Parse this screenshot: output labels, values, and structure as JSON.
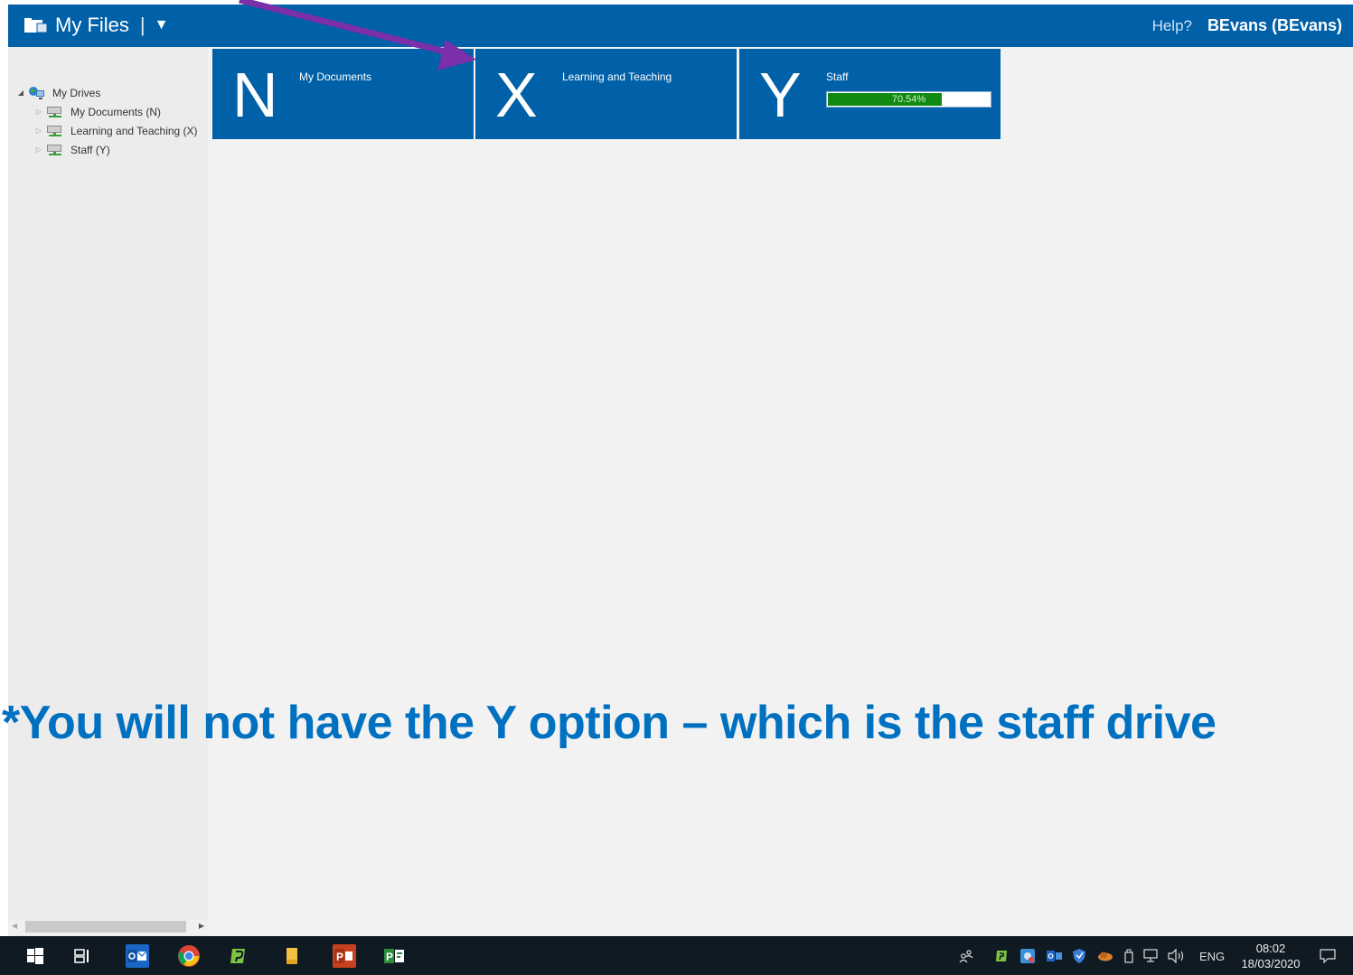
{
  "header": {
    "app_title": "My Files",
    "separator": "|",
    "dropdown_glyph": "▼",
    "help_label": "Help?",
    "user_label": "BEvans (BEvans)"
  },
  "tree": {
    "root": {
      "label": "My Drives",
      "expander": "◢",
      "icon": "network-globe-icon"
    },
    "items": [
      {
        "label": "My Documents (N)",
        "expander": "▷",
        "icon": "network-drive-icon"
      },
      {
        "label": "Learning and Teaching (X)",
        "expander": "▷",
        "icon": "network-drive-icon"
      },
      {
        "label": "Staff (Y)",
        "expander": "▷",
        "icon": "network-drive-icon"
      }
    ]
  },
  "tiles": [
    {
      "letter": "N",
      "name": "My Documents"
    },
    {
      "letter": "X",
      "name": "Learning and Teaching"
    },
    {
      "letter": "Y",
      "name": "Staff",
      "usage_text": "70.54%",
      "usage_fraction": 0.7054
    }
  ],
  "note": "*You will not have the Y option – which is the staff drive",
  "colors": {
    "header_bg": "#0060a8",
    "tile_bg": "#0060a8",
    "usage_fill": "#108a10",
    "note_text": "#0070c0",
    "arrow": "#7b2fa8"
  },
  "taskbar": {
    "apps": [
      "windows-start-icon",
      "task-view-icon",
      "outlook-icon",
      "chrome-icon",
      "publisher-green-icon",
      "file-explorer-icon",
      "powerpoint-icon",
      "project-icon"
    ],
    "tray_icons": [
      "people-icon",
      "publisher-tray-icon",
      "app-tray-icon",
      "outlook-tray-icon",
      "shield-tray-icon",
      "cloud-tray-icon",
      "usb-icon",
      "network-icon",
      "volume-icon",
      "notification-icon"
    ],
    "language": "ENG",
    "time": "08:02",
    "date": "18/03/2020"
  }
}
